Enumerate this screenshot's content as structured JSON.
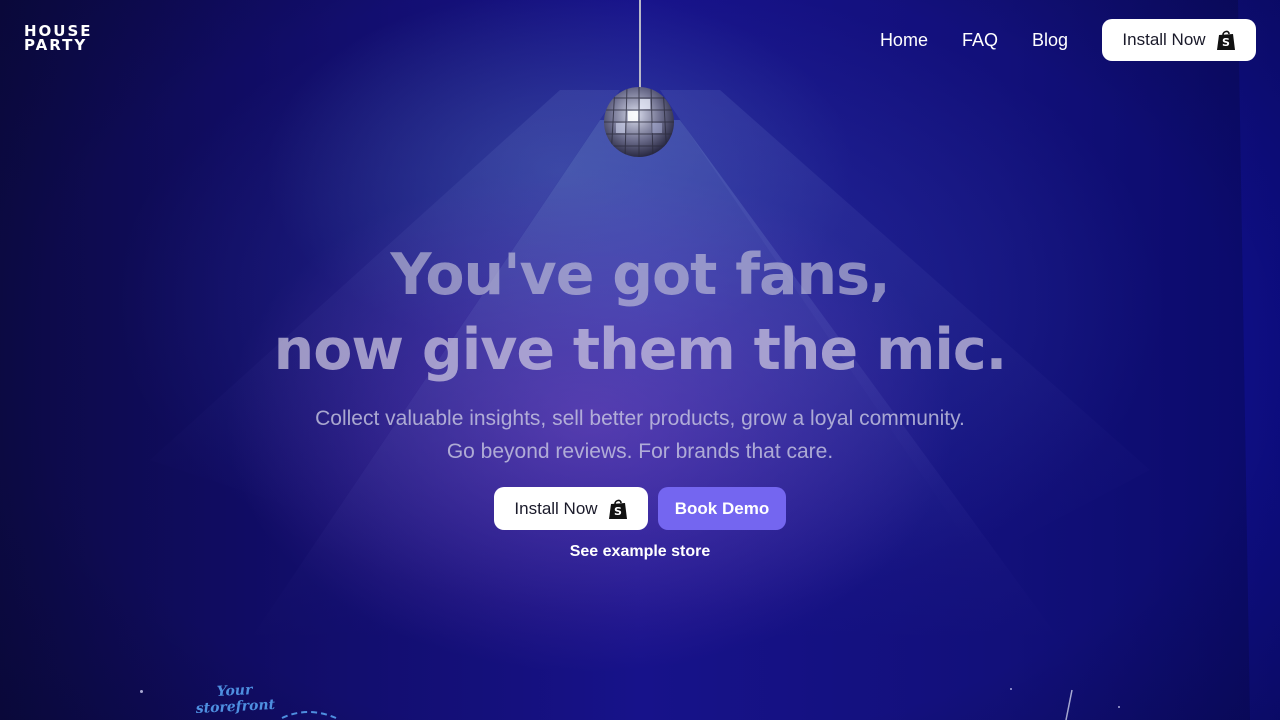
{
  "header": {
    "logo_line1": "HOUSE",
    "logo_line2": "PARTY",
    "nav": [
      {
        "label": "Home"
      },
      {
        "label": "FAQ"
      },
      {
        "label": "Blog"
      }
    ],
    "install_label": "Install Now",
    "install_icon": "shopify-bag-icon"
  },
  "hero": {
    "title_line1": "You've got fans,",
    "title_line2": "now give them the mic.",
    "subtitle_line1": "Collect valuable insights, sell better products, grow a loyal community.",
    "subtitle_line2": "Go beyond reviews. For brands that care.",
    "install_label": "Install Now",
    "install_icon": "shopify-bag-icon",
    "demo_label": "Book Demo",
    "example_link": "See example store"
  },
  "decor": {
    "ball_icon": "disco-ball-icon",
    "storefront_line1": "Your",
    "storefront_line2": "storefront"
  },
  "colors": {
    "background": "#15117f",
    "accent_purple": "#7466f0",
    "button_white": "#ffffff",
    "storefront_blue": "#4e8fe0"
  }
}
